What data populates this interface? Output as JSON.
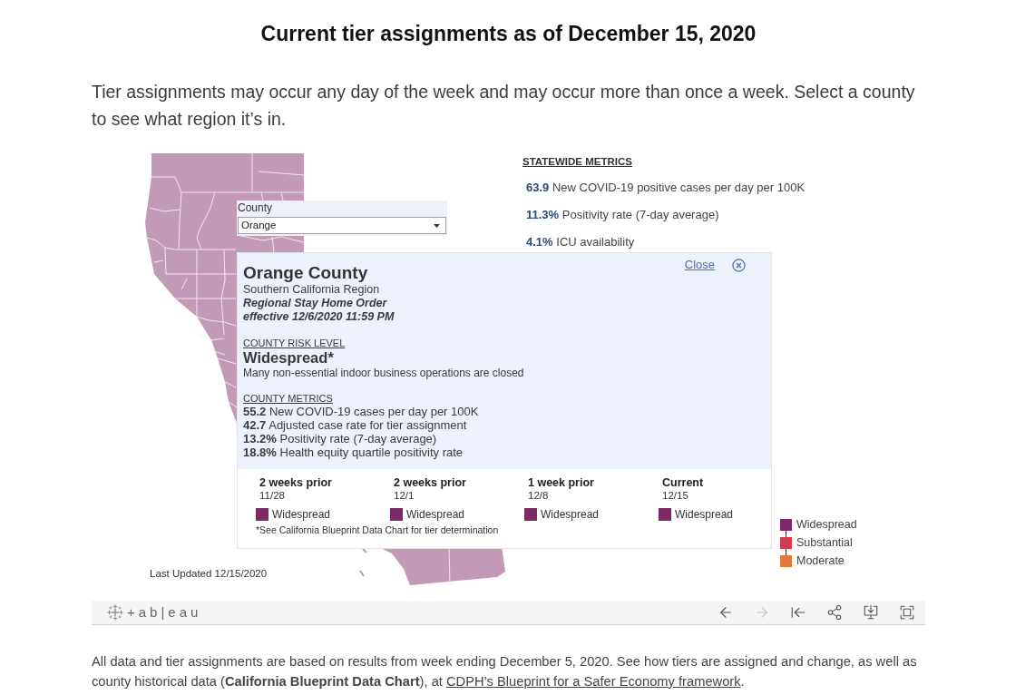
{
  "heading": "Current tier assignments as of December 15, 2020",
  "intro": "Tier assignments may occur any day of the week and may occur more than once a week. Select a county to see what region it’s in.",
  "dashboard": {
    "county_filter": {
      "label": "County",
      "value": "Orange"
    },
    "statewide_metrics": {
      "title": "STATEWIDE METRICS",
      "items": [
        {
          "value": "63.9",
          "label": "New COVID-19 positive cases per day per 100K"
        },
        {
          "value": "11.3%",
          "label": "Positivity rate (7-day average)"
        },
        {
          "value": "4.1%",
          "label": "ICU availability"
        }
      ]
    },
    "tooltip": {
      "title": "Orange County",
      "region": "Southern California Region",
      "order": "Regional Stay Home Order",
      "order_effective": "effective 12/6/2020 11:59 PM",
      "close_label": "Close",
      "risk_heading": "COUNTY RISK LEVEL",
      "risk_level": "Widespread*",
      "risk_description": "Many non-essential indoor business operations are closed",
      "metrics_heading": "COUNTY METRICS",
      "metrics": [
        "**55.2** New COVID-19 cases per day per 100K",
        "**42.7** Adjusted case rate for tier assignment",
        "**13.2%** Positivity rate (7-day average)",
        "**18.8%** Health equity quartile positivity rate"
      ],
      "history": [
        {
          "title": "2 weeks prior",
          "date": "11/28",
          "tier": "Widespread",
          "color": "#7b2a66"
        },
        {
          "title": "2 weeks prior",
          "date": "12/1",
          "tier": "Widespread",
          "color": "#7b2a66"
        },
        {
          "title": "1 week prior",
          "date": "12/8",
          "tier": "Widespread",
          "color": "#7b2a66"
        },
        {
          "title": "Current",
          "date": "12/15",
          "tier": "Widespread",
          "color": "#7b2a66"
        }
      ],
      "footnote": "*See California Blueprint Data Chart for tier determination"
    },
    "legend": [
      {
        "label": "Widespread",
        "color": "#7b2a66"
      },
      {
        "label": "Substantial",
        "color": "#d03c50"
      },
      {
        "label": "Moderate",
        "color": "#e2793b"
      }
    ],
    "last_updated": "Last Updated 12/15/2020"
  },
  "toolbar": {
    "logo": "+ab|eau",
    "buttons": [
      {
        "kind": "back",
        "disabled": false
      },
      {
        "kind": "forward",
        "disabled": true
      },
      {
        "kind": "revert",
        "disabled": false
      },
      {
        "kind": "share",
        "disabled": false
      },
      {
        "kind": "download",
        "disabled": false
      },
      {
        "kind": "fullscreen",
        "disabled": false
      }
    ]
  },
  "footer": {
    "text": "All data and tier assignments are based on results from week ending December 5, 2020. See how tiers are assigned and change, as well as county historical data (**California Blueprint Data Chart**), at ",
    "link": "CDPH’s Blueprint for a Safer Economy framework",
    "end": "."
  }
}
